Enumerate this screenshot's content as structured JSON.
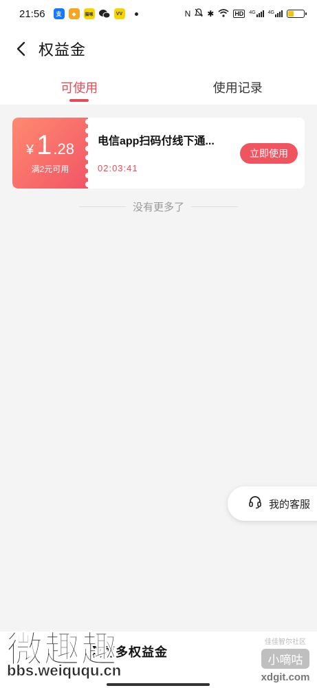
{
  "status_bar": {
    "time": "21:56",
    "apps": [
      {
        "icon": "alipay-icon",
        "glyph": "支",
        "color": "#1677ff"
      },
      {
        "icon": "app-shield-icon",
        "glyph": "◆",
        "color": "#f5a623"
      },
      {
        "icon": "app-yellow-icon",
        "glyph": "猫咪",
        "color": "#f5d400"
      },
      {
        "icon": "wechat-icon",
        "glyph": "●",
        "color": "#222222"
      },
      {
        "icon": "app-vv-icon",
        "glyph": "VV",
        "color": "#f5d400"
      }
    ],
    "network_1": "4G",
    "network_2": "4G",
    "hd": "HD",
    "battery_level": 0.35
  },
  "header": {
    "title": "权益金"
  },
  "tabs": [
    {
      "label": "可使用",
      "active": true
    },
    {
      "label": "使用记录",
      "active": false
    }
  ],
  "coupon": {
    "currency": "¥",
    "amount_int": "1",
    "amount_dec": ".28",
    "condition": "满2元可用",
    "name": "电信app扫码付线下通...",
    "countdown": "02:03:41",
    "button_label": "立即使用",
    "accent_color": "#e84a55"
  },
  "no_more": "没有更多了",
  "service": {
    "label": "我的客服"
  },
  "bottom": {
    "text": "取更多权益金"
  },
  "watermarks": {
    "left_big": "微趣趣",
    "left_url": "bbs.weiququ.cn",
    "right_small": "佳佳智尔社区",
    "right_mid": "小嘀咕",
    "right_domain": "xdgit.com"
  }
}
